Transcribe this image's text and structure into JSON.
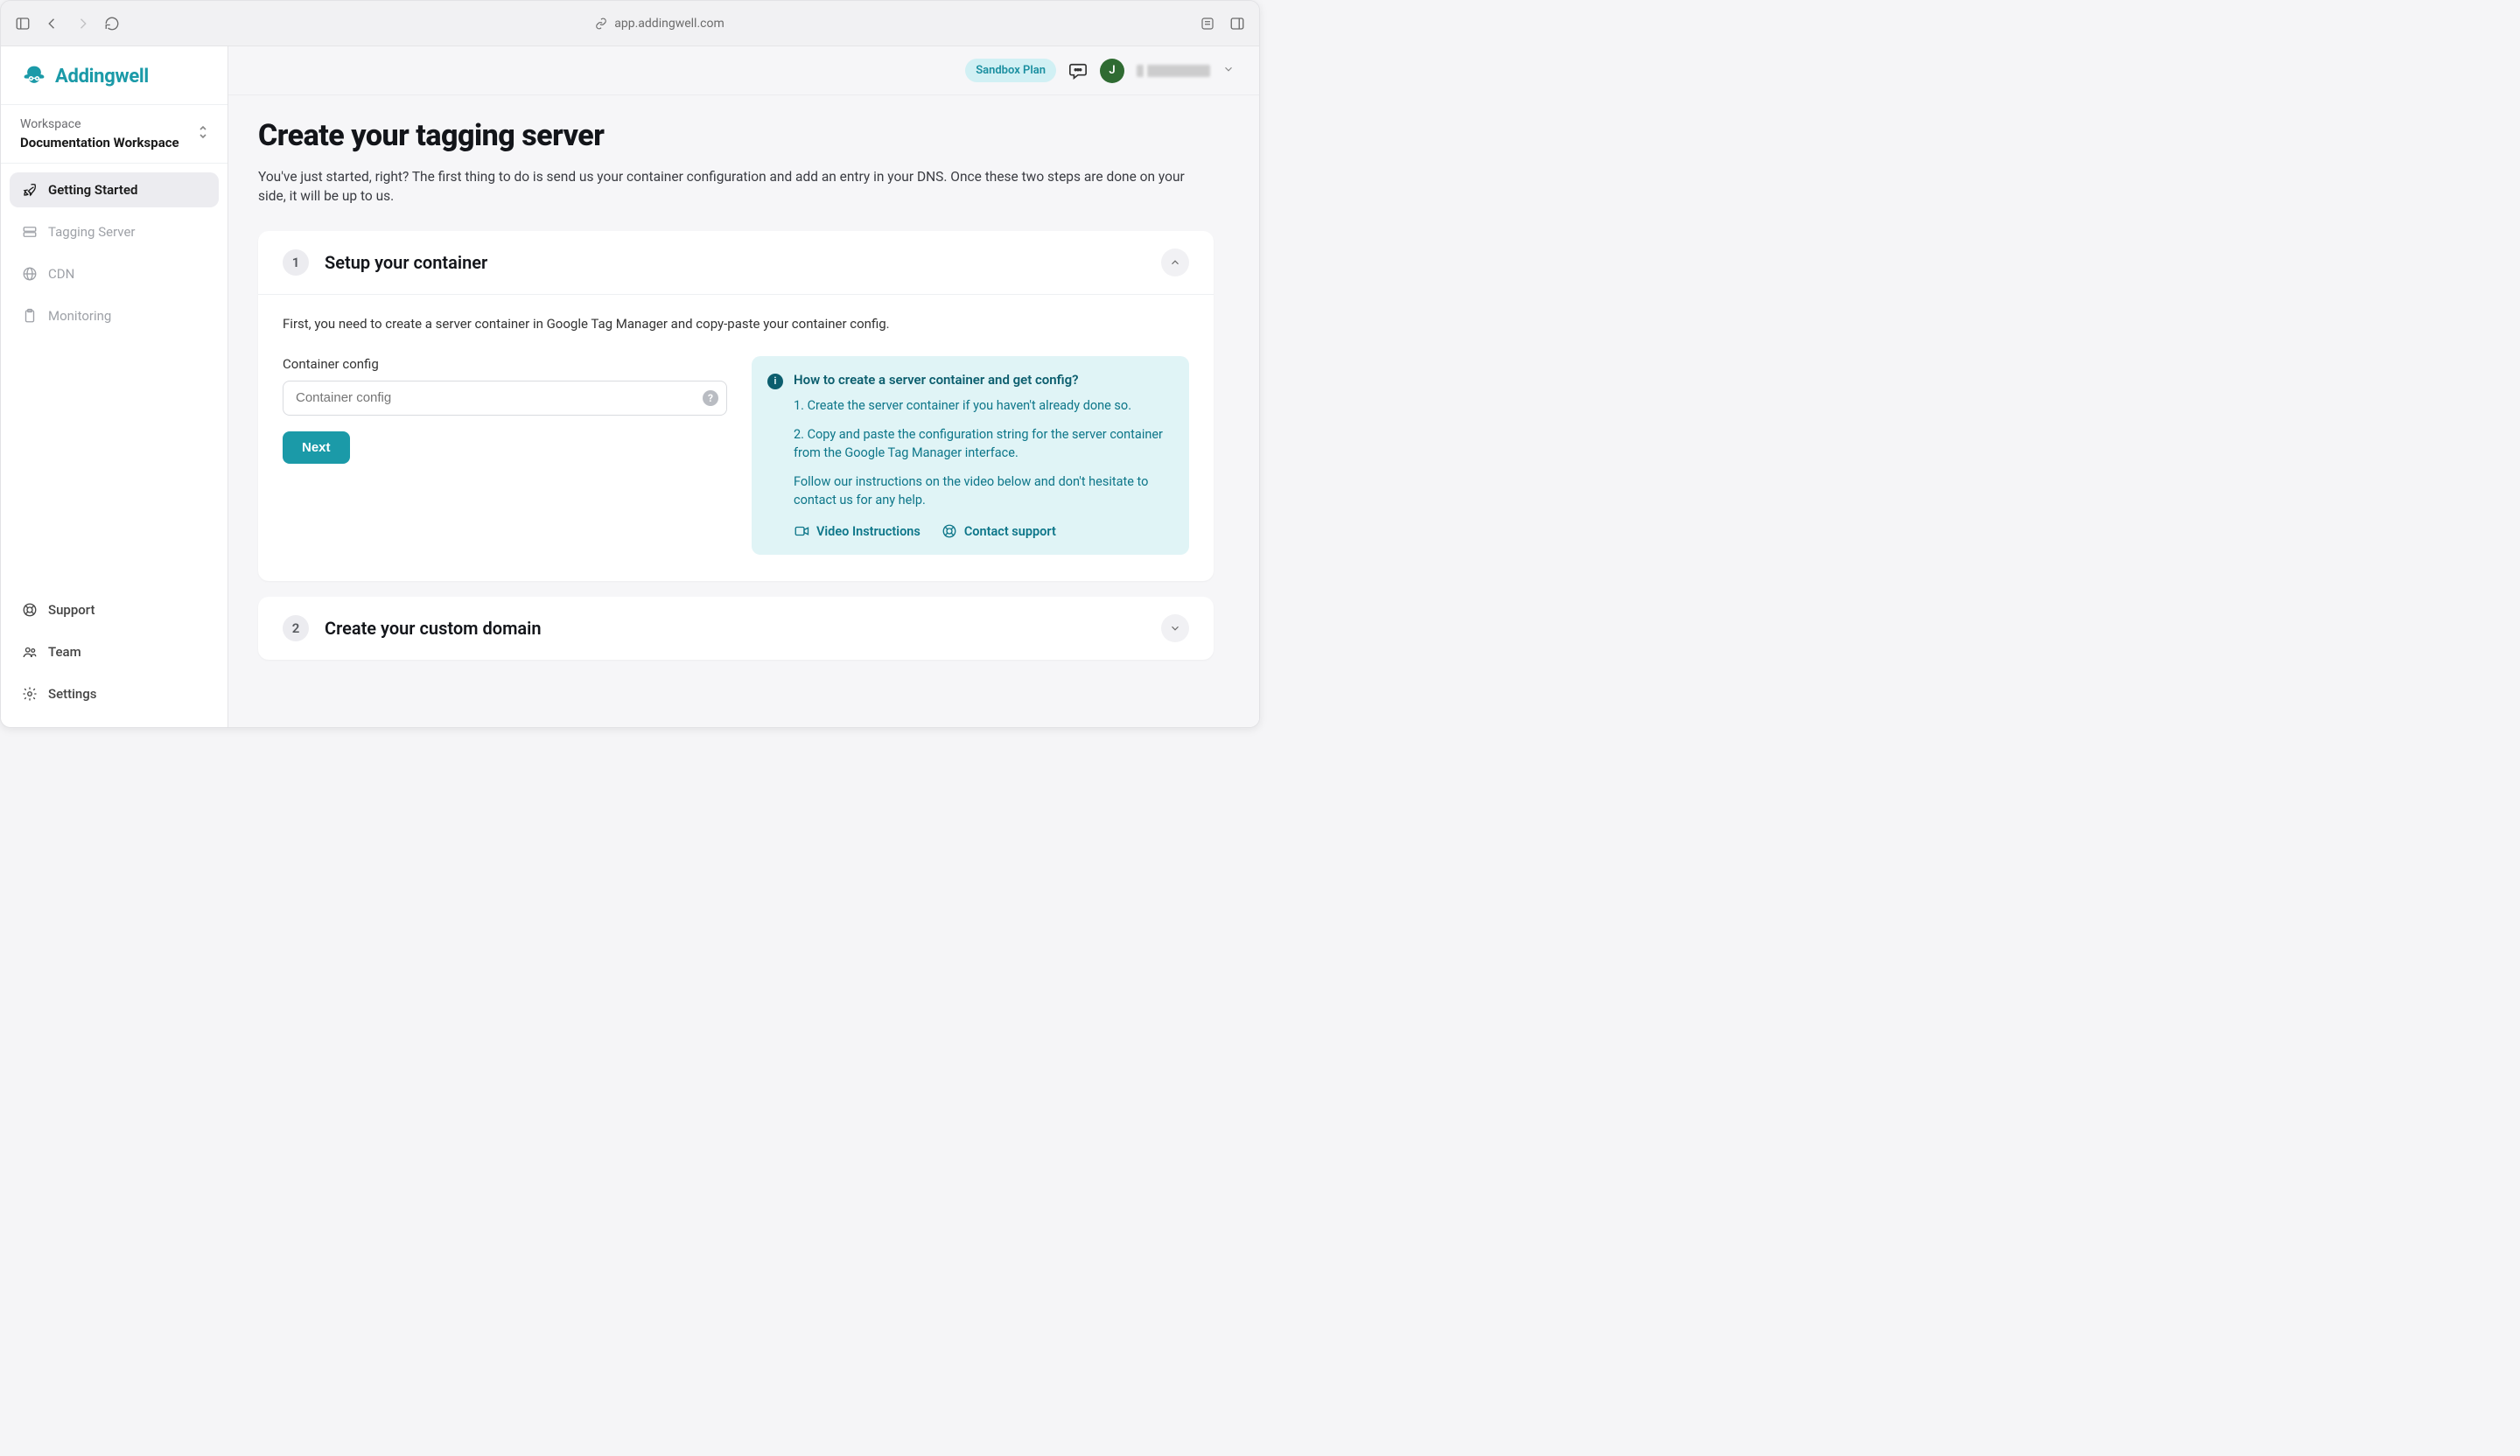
{
  "browser": {
    "url": "app.addingwell.com"
  },
  "brand": {
    "name": "Addingwell",
    "accent": "#1b9aa8"
  },
  "workspace": {
    "label": "Workspace",
    "name": "Documentation Workspace"
  },
  "sidebar": {
    "items": [
      {
        "label": "Getting Started",
        "active": true
      },
      {
        "label": "Tagging Server",
        "active": false
      },
      {
        "label": "CDN",
        "active": false
      },
      {
        "label": "Monitoring",
        "active": false
      }
    ]
  },
  "footerNav": {
    "items": [
      {
        "label": "Support"
      },
      {
        "label": "Team"
      },
      {
        "label": "Settings"
      }
    ]
  },
  "topbar": {
    "plan": "Sandbox Plan",
    "avatar_initial": "J"
  },
  "page": {
    "title": "Create your tagging server",
    "description": "You've just started, right? The first thing to do is send us your container configuration and add an entry in your DNS. Once these two steps are done on your side, it will be up to us."
  },
  "steps": [
    {
      "num": "1",
      "title": "Setup your container",
      "expanded": true,
      "intro": "First, you need to create a server container in Google Tag Manager and copy-paste your container config.",
      "field_label": "Container config",
      "field_placeholder": "Container config",
      "submit_label": "Next",
      "info": {
        "title": "How to create a server container and get config?",
        "line1": "1. Create the server container if you haven't already done so.",
        "line2": "2. Copy and paste the configuration string for the server container from the Google Tag Manager interface.",
        "followup": "Follow our instructions on the video below and don't hesitate to contact us for any help.",
        "video_link": "Video Instructions",
        "contact_link": "Contact support"
      }
    },
    {
      "num": "2",
      "title": "Create your custom domain",
      "expanded": false
    }
  ]
}
